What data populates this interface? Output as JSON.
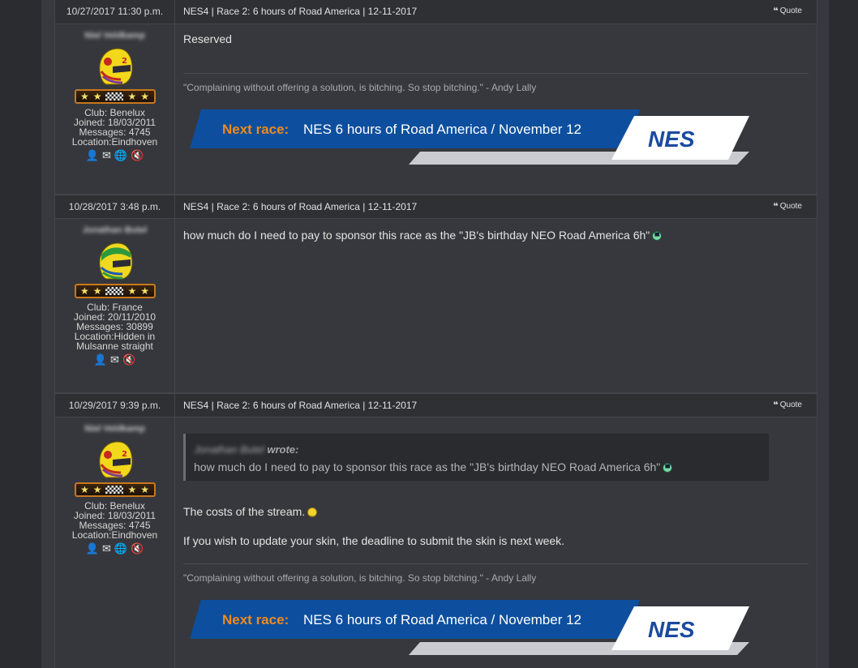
{
  "posts": [
    {
      "date": "10/27/2017 11:30 p.m.",
      "subject": "NES4 | Race 2: 6 hours of Road America | 12-11-2017",
      "quote_label": "Quote",
      "author": {
        "name": "Niel Veldkamp",
        "club": "Club: Benelux",
        "joined": "Joined: 18/03/2011",
        "messages": "Messages: 4745",
        "location": "Location:Eindhoven"
      },
      "body": "Reserved",
      "signature": "\"Complaining without offering a solution, is bitching. So stop bitching.\" - Andy Lally",
      "banner": {
        "next_label": "Next race:",
        "event": "NES 6 hours of Road America  / November 12",
        "logo": "NES"
      }
    },
    {
      "date": "10/28/2017 3:48 p.m.",
      "subject": "NES4 | Race 2: 6 hours of Road America | 12-11-2017",
      "quote_label": "Quote",
      "author": {
        "name": "Jonathan Butel",
        "club": "Club: France",
        "joined": "Joined: 20/11/2010",
        "messages": "Messages: 30899",
        "location_line1": "Location:Hidden in",
        "location_line2": "Mulsanne straight"
      },
      "body": "how much do I need to pay to sponsor this race as the \"JB's birthday NEO Road America 6h\""
    },
    {
      "date": "10/29/2017 9:39 p.m.",
      "subject": "NES4 | Race 2: 6 hours of Road America | 12-11-2017",
      "quote_label": "Quote",
      "author": {
        "name": "Niel Veldkamp",
        "club": "Club: Benelux",
        "joined": "Joined: 18/03/2011",
        "messages": "Messages: 4745",
        "location": "Location:Eindhoven"
      },
      "quoted": {
        "author": "Jonathan Butel",
        "wrote": "wrote:",
        "text": "how much do I need to pay to sponsor this race as the \"JB's birthday NEO Road America 6h\""
      },
      "body_line1": "The costs of the stream.",
      "body_line2": "If you wish to update your skin, the deadline to submit the skin is next week.",
      "signature": "\"Complaining without offering a solution, is bitching. So stop bitching.\" - Andy Lally",
      "banner": {
        "next_label": "Next race:",
        "event": "NES 6 hours of Road America  / November 12",
        "logo": "NES"
      }
    }
  ],
  "icons": {
    "profile": "profile-icon",
    "message": "envelope-icon",
    "website": "globe-icon",
    "mute": "mute-icon"
  },
  "colors": {
    "banner_blue": "#0d4f9e",
    "banner_orange": "#f08a1c",
    "nes_blue": "#1a4aa0"
  }
}
